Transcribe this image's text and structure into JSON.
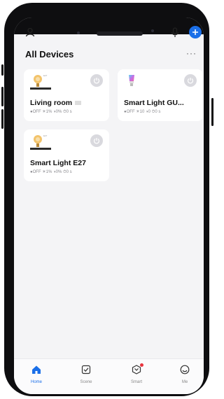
{
  "header": {
    "title": "All Devices",
    "more_label": "···",
    "icons": {
      "profile": "person-outline-icon",
      "mic": "microphone-icon",
      "add": "plus-icon"
    },
    "accent_color": "#1b6fe8"
  },
  "devices": [
    {
      "name": "Living room",
      "stats": "●OFF  ☀1%  ◑0%  ⏱0 s",
      "group": true,
      "thumb": "bulb-filament-icon"
    },
    {
      "name": "Smart Light GU...",
      "stats": "●OFF  ☀10  ◑0  ⏱0 s",
      "group": false,
      "thumb": "bulb-rgb-icon"
    },
    {
      "name": "Smart Light E27",
      "stats": "●OFF  ☀1%  ◑0%  ⏱0 s",
      "group": false,
      "thumb": "bulb-filament-icon"
    }
  ],
  "tabbar": {
    "tabs": [
      {
        "label": "Home",
        "icon": "home-icon",
        "active": true
      },
      {
        "label": "Scene",
        "icon": "checkbox-icon",
        "active": false
      },
      {
        "label": "Smart",
        "icon": "smart-icon",
        "active": false
      },
      {
        "label": "Me",
        "icon": "smiley-icon",
        "active": false
      }
    ]
  }
}
